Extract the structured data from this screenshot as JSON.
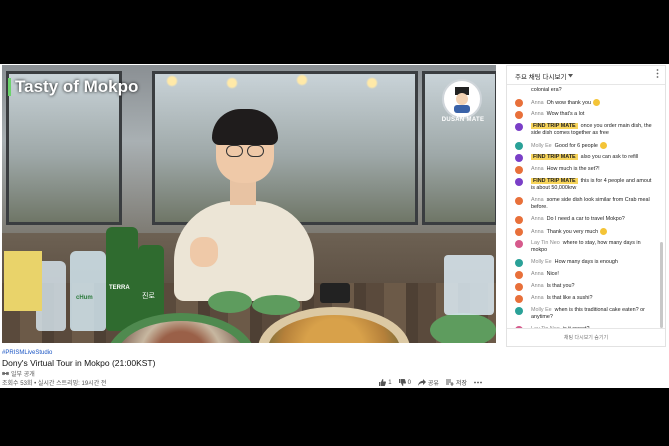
{
  "video": {
    "overlay_title": "Tasty of Mokpo",
    "logo_text": "DUSAN MATE",
    "bottle_labels": [
      "TERRA",
      "TERRA",
      "cHum",
      "진로"
    ]
  },
  "meta": {
    "hashtag": "#PRISMLiveStudio",
    "title": "Dony's Virtual Tour in Mokpo (21:00KST)",
    "channel": "일부 공개",
    "views": "조회수 53회 • 실시간 스트리밍: 19시간 전",
    "likes": "1",
    "dislikes": "0",
    "share": "공유",
    "save": "저장"
  },
  "chat": {
    "header": "주요 채팅 다시보기",
    "footer": "채팅 다시보기 숨기기",
    "colors": {
      "orange": "#e8703a",
      "purple": "#7a3fc7",
      "teal": "#2aa198",
      "pink": "#d65a8c"
    },
    "messages": [
      {
        "name": "",
        "text": "colonial era?",
        "badge": "",
        "color": "none",
        "emoji": false
      },
      {
        "name": "Anna",
        "text": "Oh wow thank you",
        "badge": "",
        "color": "orange",
        "emoji": true
      },
      {
        "name": "Anna",
        "text": "Wow that's a lot",
        "badge": "",
        "color": "orange",
        "emoji": false
      },
      {
        "name": "",
        "text": "once you order main dish, the side dish comes together as free",
        "badge": "FIND TRIP MATE",
        "color": "purple",
        "emoji": false
      },
      {
        "name": "Molly Ee",
        "text": "Good for 6 people",
        "badge": "",
        "color": "teal",
        "emoji": true
      },
      {
        "name": "",
        "text": "also you can ask to refill",
        "badge": "FIND TRIP MATE",
        "color": "purple",
        "emoji": false
      },
      {
        "name": "Anna",
        "text": "How much is the set?!",
        "badge": "",
        "color": "orange",
        "emoji": false
      },
      {
        "name": "",
        "text": "this is for 4 people and amout is about 50,000krw",
        "badge": "FIND TRIP MATE",
        "color": "purple",
        "emoji": false
      },
      {
        "name": "Anna",
        "text": "some side dish look similar from Crab meal before.",
        "badge": "",
        "color": "orange",
        "emoji": false
      },
      {
        "name": "Anna",
        "text": "Do I need a car to travel Mokpo?",
        "badge": "",
        "color": "orange",
        "emoji": false
      },
      {
        "name": "Anna",
        "text": "Thank you very much",
        "badge": "",
        "color": "orange",
        "emoji": true
      },
      {
        "name": "Lay Tin Neo",
        "text": "where to stay, how many days in mokpo",
        "badge": "",
        "color": "pink",
        "emoji": false
      },
      {
        "name": "Molly Ee",
        "text": "How many days is enough",
        "badge": "",
        "color": "teal",
        "emoji": false
      },
      {
        "name": "Anna",
        "text": "Nice!",
        "badge": "",
        "color": "orange",
        "emoji": false
      },
      {
        "name": "Anna",
        "text": "Is that you?",
        "badge": "",
        "color": "orange",
        "emoji": false
      },
      {
        "name": "Anna",
        "text": "Is that like a sushi?",
        "badge": "",
        "color": "orange",
        "emoji": false
      },
      {
        "name": "Molly Ee",
        "text": "when is this traditional cake eaten? or anytime?",
        "badge": "",
        "color": "teal",
        "emoji": false
      },
      {
        "name": "Lay Tin Neo",
        "text": "is it sweet?",
        "badge": "",
        "color": "pink",
        "emoji": false
      }
    ]
  }
}
